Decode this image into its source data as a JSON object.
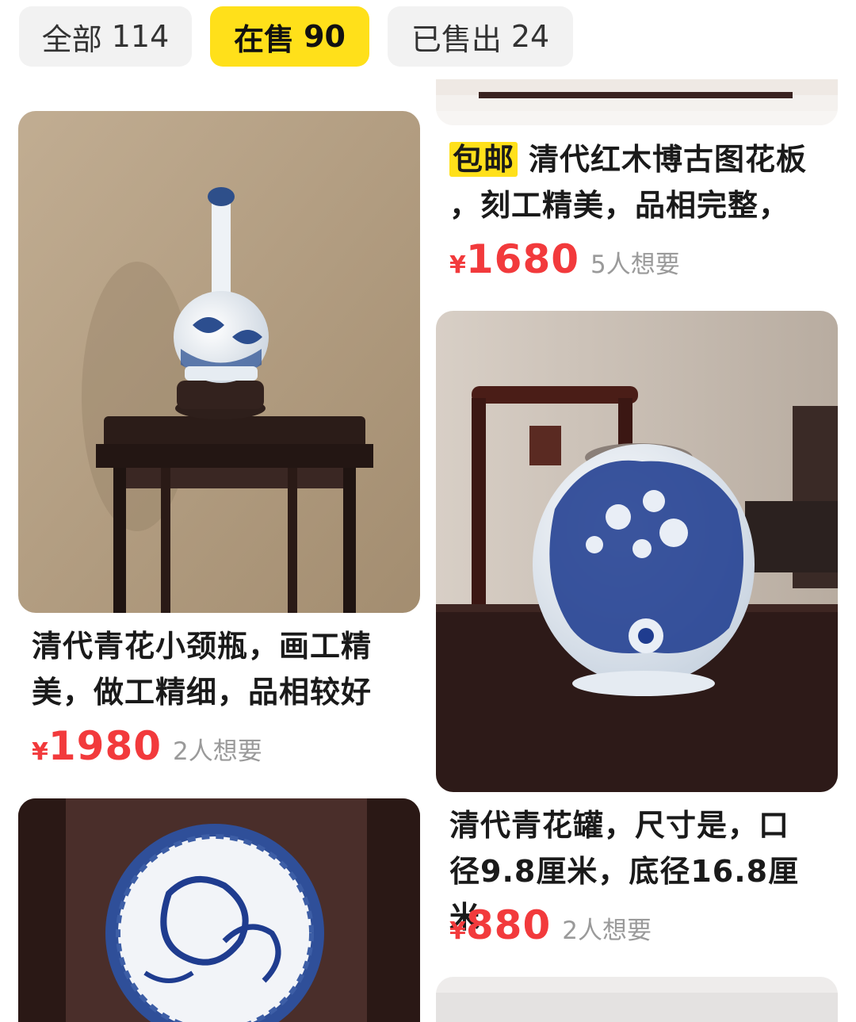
{
  "tabs": [
    {
      "label": "全部",
      "count": "114",
      "active": false
    },
    {
      "label": "在售",
      "count": "90",
      "active": true
    },
    {
      "label": "已售出",
      "count": "24",
      "active": false
    }
  ],
  "products": [
    {
      "title_line1": "清代青花小颈瓶，画工精",
      "title_line2": "美，做工精细，品相较好",
      "currency": "¥",
      "price": "1980",
      "wants": "2人想要"
    },
    {
      "tag": "包邮",
      "title_line1": "清代红木博古图花板",
      "title_line2": "，刻工精美，品相完整，",
      "currency": "¥",
      "price": "1680",
      "wants": "5人想要"
    },
    {
      "title_line1": "清代青花罐，尺寸是，口",
      "title_line2": "径9.8厘米，底径16.8厘米",
      "currency": "¥",
      "price": "880",
      "wants": "2人想要"
    }
  ],
  "colors": {
    "accent_yellow": "#ffe01a",
    "price_red": "#f23a3c",
    "muted_gray": "#9a9a9a"
  }
}
